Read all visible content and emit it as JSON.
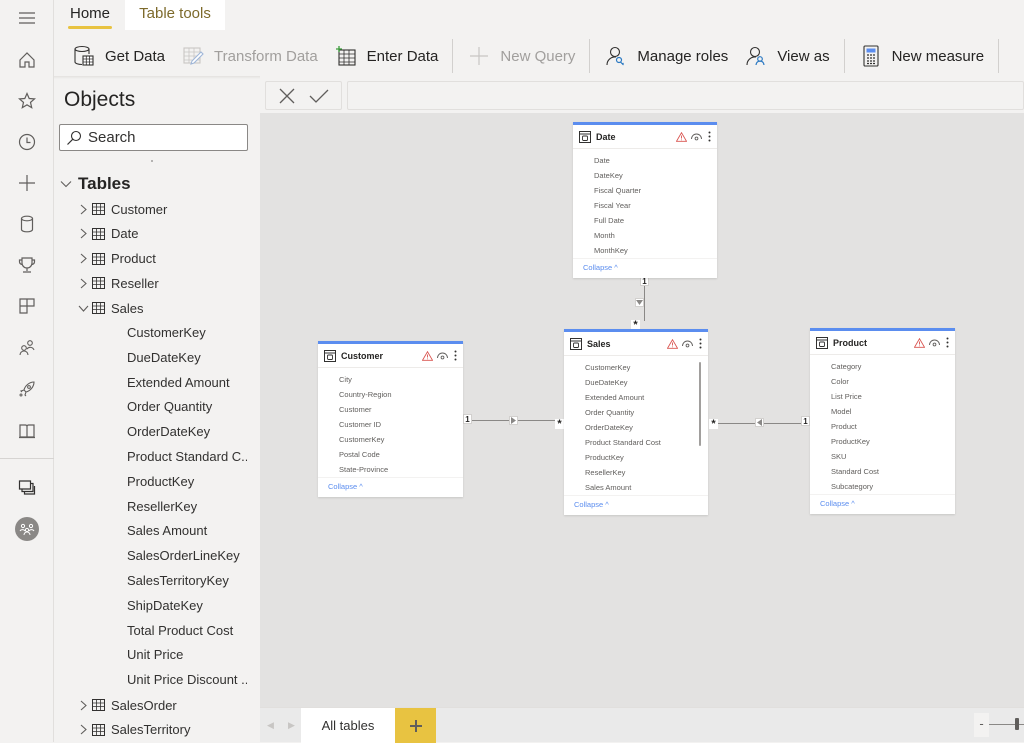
{
  "ribbon_tabs": [
    {
      "label": "Home",
      "active": true
    },
    {
      "label": "Table tools",
      "active": false
    }
  ],
  "ribbon": {
    "buttons": [
      {
        "label": "Get Data",
        "icon": "database-table-icon",
        "enabled": true
      },
      {
        "label": "Transform Data",
        "icon": "table-edit-icon",
        "enabled": false
      },
      {
        "label": "Enter Data",
        "icon": "table-add-icon",
        "enabled": true
      },
      {
        "label": "New Query",
        "icon": "plus-icon",
        "enabled": false
      },
      {
        "label": "Manage roles",
        "icon": "person-key-icon",
        "enabled": true
      },
      {
        "label": "View as",
        "icon": "person-view-icon",
        "enabled": true
      },
      {
        "label": "New measure",
        "icon": "calculator-icon",
        "enabled": true
      }
    ]
  },
  "left_rail": {
    "icons": [
      "menu-icon",
      "home-icon",
      "favorites-star-icon",
      "recent-clock-icon",
      "create-plus-icon",
      "datasets-icon",
      "goals-trophy-icon",
      "apps-icon",
      "shared-people-icon",
      "deployment-rocket-icon",
      "learn-book-icon",
      "workspaces-icon",
      "workspace-avatar-icon"
    ]
  },
  "objects_pane": {
    "title": "Objects",
    "search_placeholder": "Search",
    "tables_label": "Tables",
    "tables": [
      {
        "name": "Customer",
        "expanded": false
      },
      {
        "name": "Date",
        "expanded": false
      },
      {
        "name": "Product",
        "expanded": false
      },
      {
        "name": "Reseller",
        "expanded": false
      },
      {
        "name": "Sales",
        "expanded": true,
        "fields": [
          "CustomerKey",
          "DueDateKey",
          "Extended Amount",
          "Order Quantity",
          "OrderDateKey",
          "Product Standard C...",
          "ProductKey",
          "ResellerKey",
          "Sales Amount",
          "SalesOrderLineKey",
          "SalesTerritoryKey",
          "ShipDateKey",
          "Total Product Cost",
          "Unit Price",
          "Unit Price Discount ..."
        ]
      },
      {
        "name": "SalesOrder",
        "expanded": false
      },
      {
        "name": "SalesTerritory",
        "expanded": false
      }
    ]
  },
  "formula_bar": {
    "value": ""
  },
  "diagram": {
    "cards": [
      {
        "name": "Date",
        "fields": [
          "Date",
          "DateKey",
          "Fiscal Quarter",
          "Fiscal Year",
          "Full Date",
          "Month",
          "MonthKey"
        ],
        "collapse_label": "Collapse"
      },
      {
        "name": "Customer",
        "fields": [
          "City",
          "Country-Region",
          "Customer",
          "Customer ID",
          "CustomerKey",
          "Postal Code",
          "State-Province"
        ],
        "collapse_label": "Collapse"
      },
      {
        "name": "Sales",
        "fields": [
          "CustomerKey",
          "DueDateKey",
          "Extended Amount",
          "Order Quantity",
          "OrderDateKey",
          "Product Standard Cost",
          "ProductKey",
          "ResellerKey",
          "Sales Amount"
        ],
        "collapse_label": "Collapse"
      },
      {
        "name": "Product",
        "fields": [
          "Category",
          "Color",
          "List Price",
          "Model",
          "Product",
          "ProductKey",
          "SKU",
          "Standard Cost",
          "Subcategory"
        ],
        "collapse_label": "Collapse"
      }
    ],
    "relationships": [
      {
        "from": "Date",
        "to": "Sales",
        "from_cardinality": "1",
        "to_cardinality": "*"
      },
      {
        "from": "Customer",
        "to": "Sales",
        "from_cardinality": "1",
        "to_cardinality": "*"
      },
      {
        "from": "Product",
        "to": "Sales",
        "from_cardinality": "1",
        "to_cardinality": "*"
      }
    ]
  },
  "bottom_bar": {
    "tab_label": "All tables",
    "add_label": "+",
    "zoom_minus": "-"
  },
  "colors": {
    "accent_yellow": "#e8c341",
    "card_border_blue": "#5b8def",
    "warning": "#d9534f"
  }
}
